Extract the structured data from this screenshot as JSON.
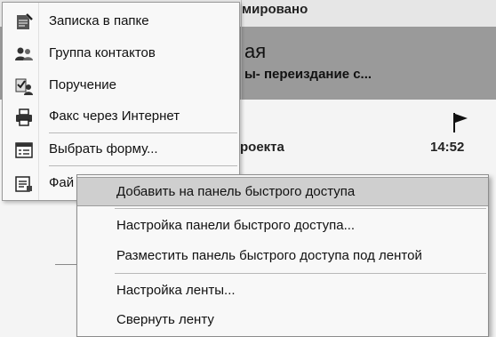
{
  "background": {
    "header_fragment": "мировано",
    "band_title": "ая",
    "band_subtitle": "ы- переиздание с...",
    "item_text": "роекта",
    "item_time": "14:52"
  },
  "new_items_menu": {
    "items": [
      {
        "label": "Записка в папке",
        "icon": "note-icon"
      },
      {
        "label": "Группа контактов",
        "icon": "contact-group-icon"
      },
      {
        "label": "Поручение",
        "icon": "task-request-icon"
      },
      {
        "label": "Факс через Интернет",
        "icon": "fax-icon"
      },
      {
        "label": "Выбрать форму...",
        "icon": "form-icon"
      },
      {
        "label": "Фай",
        "icon": "file-icon"
      }
    ]
  },
  "context_menu": {
    "items": [
      {
        "label": "Добавить на панель быстрого доступа"
      },
      {
        "label": "Настройка панели быстрого доступа..."
      },
      {
        "label": "Разместить панель быстрого доступа под лентой"
      },
      {
        "label": "Настройка ленты..."
      },
      {
        "label": "Свернуть ленту"
      }
    ]
  }
}
